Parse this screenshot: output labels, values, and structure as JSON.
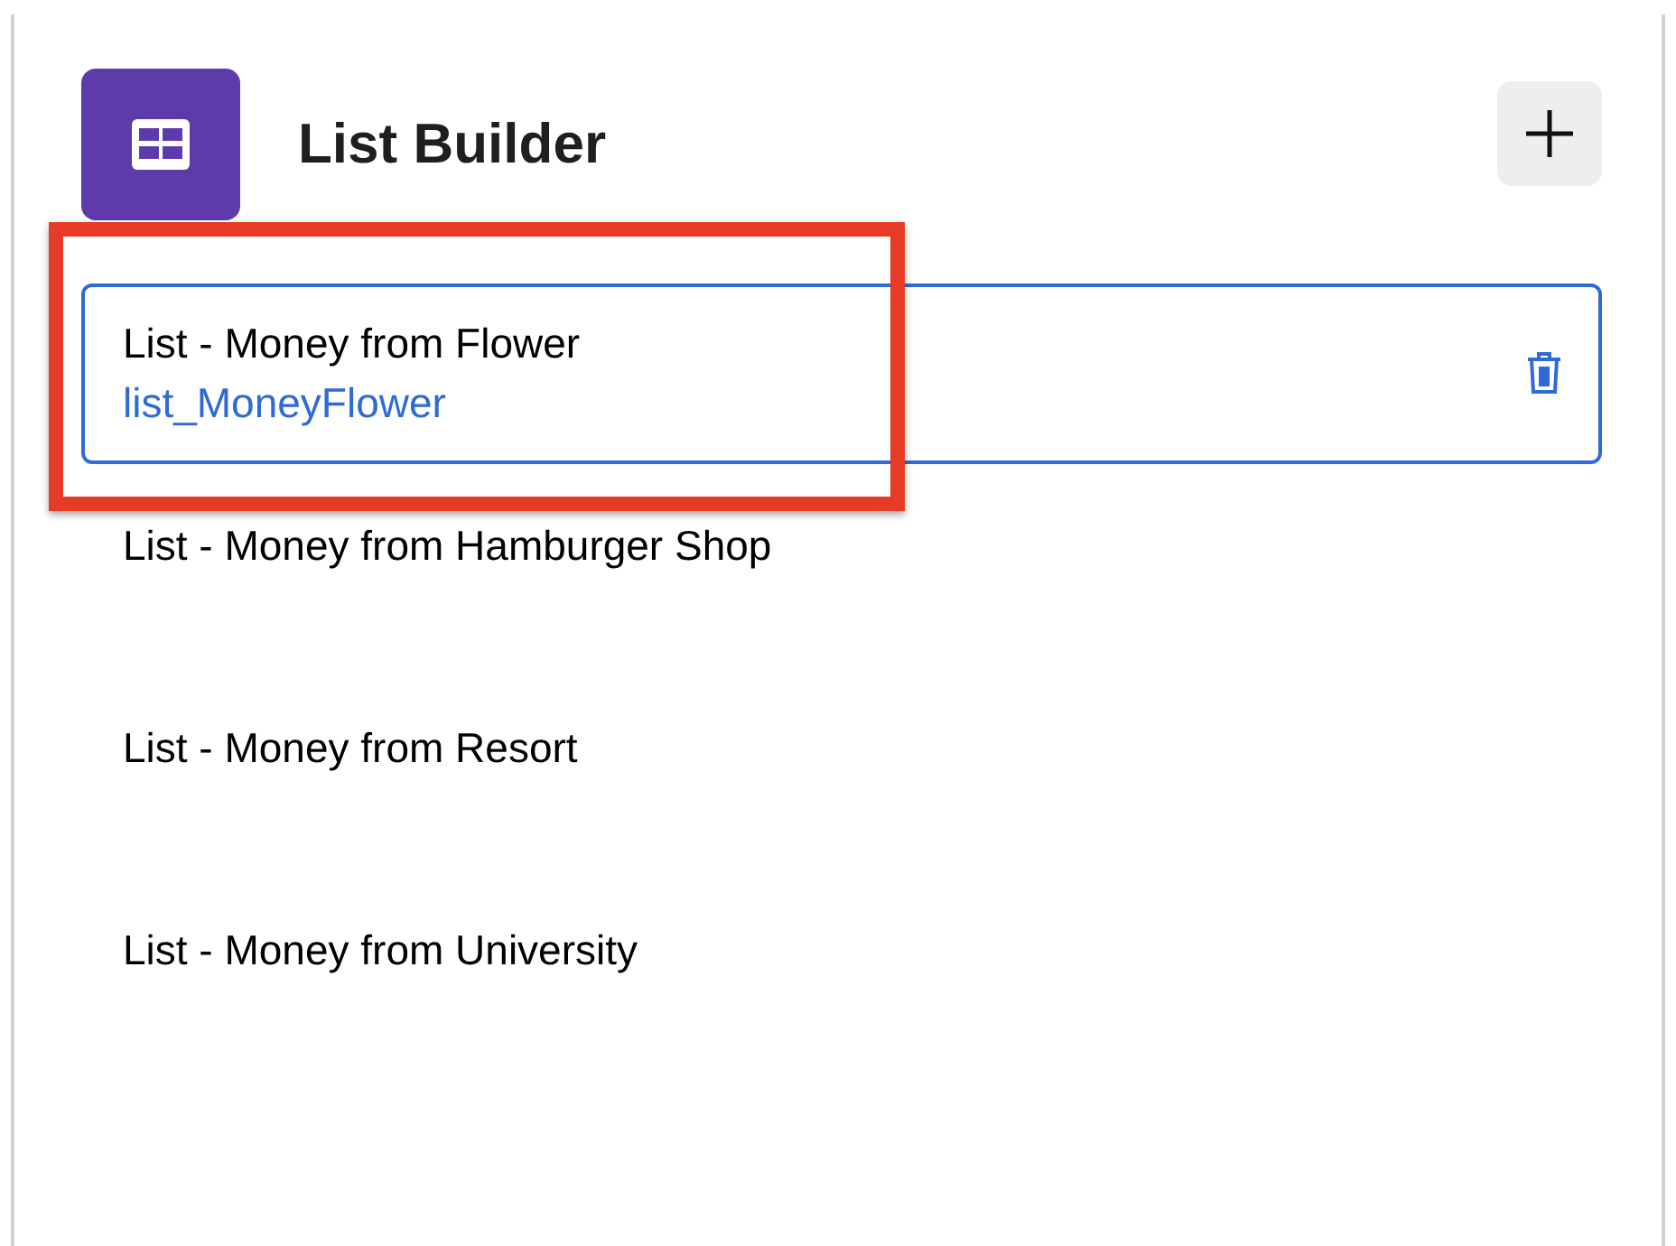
{
  "header": {
    "title": "List Builder"
  },
  "items": [
    {
      "label": "List - Money from Flower",
      "api_name": "list_MoneyFlower",
      "selected": true
    },
    {
      "label": "List - Money from Hamburger Shop",
      "selected": false
    },
    {
      "label": "List - Money from Resort",
      "selected": false
    },
    {
      "label": "List - Money from University",
      "selected": false
    }
  ]
}
